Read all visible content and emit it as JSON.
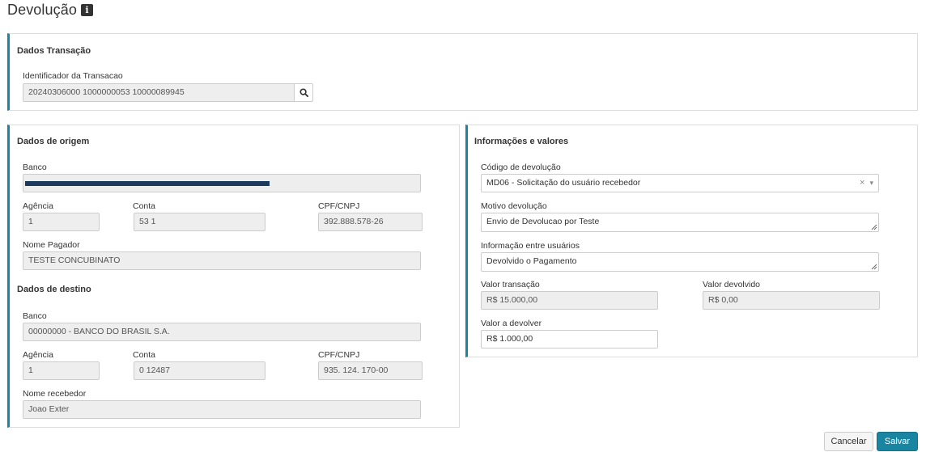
{
  "page": {
    "title": "Devolução",
    "info_icon": "info-icon"
  },
  "transacao": {
    "title": "Dados Transação",
    "id_label": "Identificador da Transacao",
    "id_value": "20240306000 1000000053 10000089945",
    "search_icon": "search-icon"
  },
  "origem": {
    "title": "Dados de origem",
    "banco_label": "Banco",
    "banco_value": "",
    "agencia_label": "Agência",
    "agencia_value": "1",
    "conta_label": "Conta",
    "conta_value": "53 1",
    "cpf_label": "CPF/CNPJ",
    "cpf_value": "392.888.578-26",
    "nome_label": "Nome Pagador",
    "nome_value": "TESTE CONCUBINATO"
  },
  "destino": {
    "title": "Dados de destino",
    "banco_label": "Banco",
    "banco_value": "00000000 - BANCO DO BRASIL S.A.",
    "agencia_label": "Agência",
    "agencia_value": "1",
    "conta_label": "Conta",
    "conta_value": "0 12487",
    "cpf_label": "CPF/CNPJ",
    "cpf_value": "935. 124. 170-00",
    "nome_label": "Nome recebedor",
    "nome_value": "Joao Exter"
  },
  "informacoes": {
    "title": "Informações e valores",
    "codigo_label": "Código de devolução",
    "codigo_value": "MD06 - Solicitação do usuário recebedor",
    "clear_glyph": "×",
    "arrow_glyph": "▾",
    "motivo_label": "Motivo devolução",
    "motivo_value": "Envio de Devolucao por Teste",
    "info_label": "Informação entre usuários",
    "info_value": "Devolvido o Pagamento",
    "valor_transacao_label": "Valor transação",
    "valor_transacao_value": "R$ 15.000,00",
    "valor_devolvido_label": "Valor devolvido",
    "valor_devolvido_value": "R$ 0,00",
    "valor_devolver_label": "Valor a devolver",
    "valor_devolver_value": "R$ 1.000,00"
  },
  "actions": {
    "cancel_label": "Cancelar",
    "save_label": "Salvar"
  },
  "colors": {
    "accent": "#1a85a1",
    "redaction": "#1b3a5c"
  }
}
